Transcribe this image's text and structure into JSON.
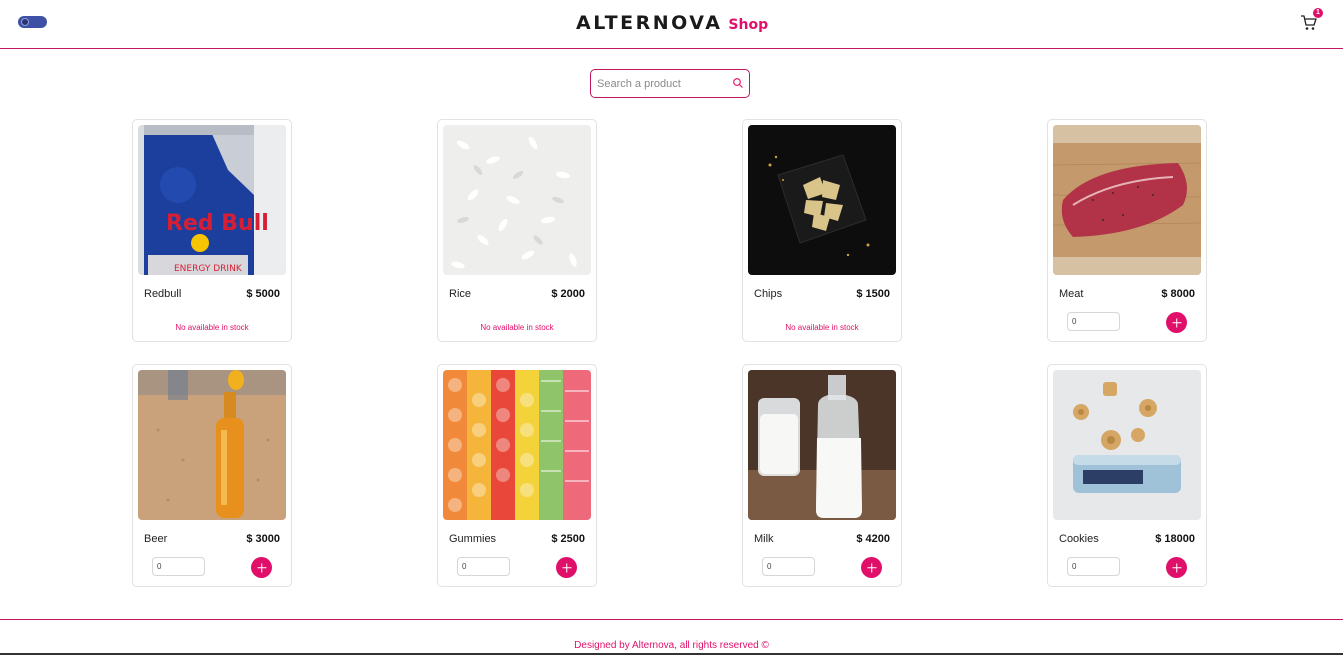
{
  "header": {
    "brand_name": "ALTERNOVA",
    "brand_suffix": "Shop",
    "cart_count": "1",
    "theme_toggle": "dark-mode-toggle",
    "cart_icon": "cart-icon"
  },
  "search": {
    "placeholder": "Search a product",
    "value": "",
    "icon": "search-icon"
  },
  "products": [
    {
      "name": "Redbull",
      "price": "$ 5000",
      "stock_message": "No available in stock",
      "in_stock": false,
      "image": "redbull-can"
    },
    {
      "name": "Rice",
      "price": "$ 2000",
      "stock_message": "No available in stock",
      "in_stock": false,
      "image": "rice-grains"
    },
    {
      "name": "Chips",
      "price": "$ 1500",
      "stock_message": "No available in stock",
      "in_stock": false,
      "image": "chips-plate"
    },
    {
      "name": "Meat",
      "price": "$ 8000",
      "quantity": "0",
      "in_stock": true,
      "image": "steak-board"
    },
    {
      "name": "Beer",
      "price": "$ 3000",
      "quantity": "0",
      "in_stock": true,
      "image": "beer-bottle-sand"
    },
    {
      "name": "Gummies",
      "price": "$ 2500",
      "quantity": "0",
      "in_stock": true,
      "image": "gummy-candies"
    },
    {
      "name": "Milk",
      "price": "$ 4200",
      "quantity": "0",
      "in_stock": true,
      "image": "milk-bottle-glass"
    },
    {
      "name": "Cookies",
      "price": "$ 18000",
      "quantity": "0",
      "in_stock": true,
      "image": "cookies-tin"
    }
  ],
  "footer": {
    "text": "Designed by Alternova, all rights reserved ©"
  },
  "colors": {
    "accent": "#e0106a",
    "border_accent": "#c2185b",
    "toggle": "#3f51a4"
  }
}
